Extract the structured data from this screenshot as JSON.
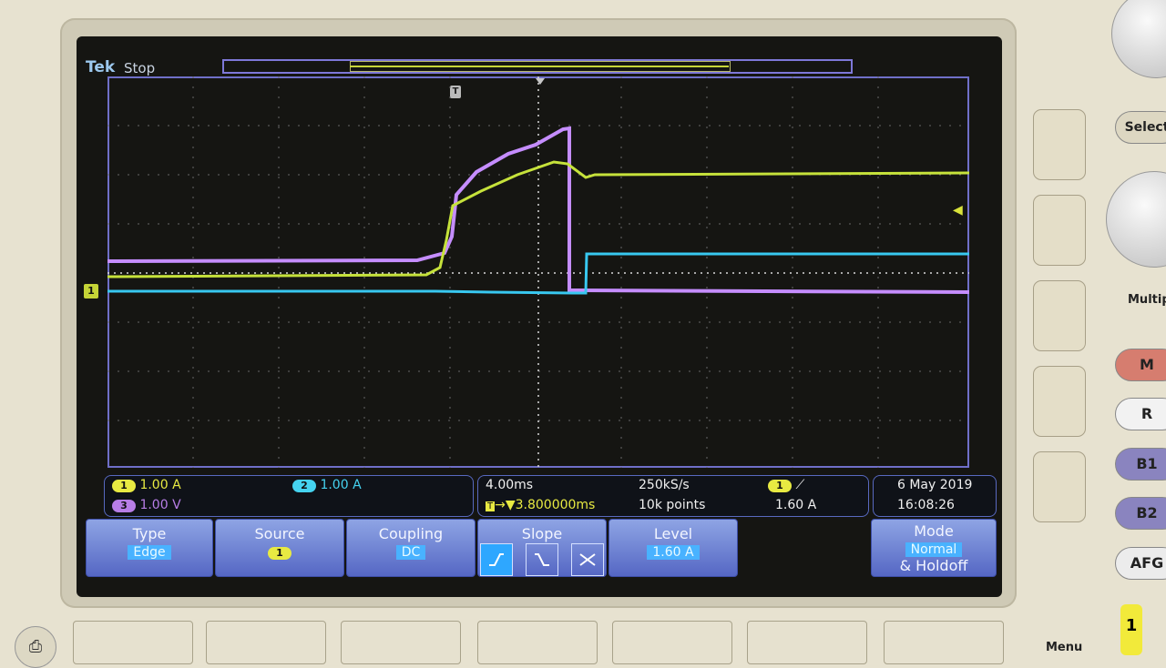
{
  "brand": "Tek",
  "acquisition_state": "Stop",
  "trigger_position_marker": "T",
  "channel_marker": "1",
  "status": {
    "channels": [
      {
        "id": "1",
        "scale": "1.00 A",
        "color": "#e8ea42"
      },
      {
        "id": "2",
        "scale": "1.00 A",
        "color": "#45d3f0"
      },
      {
        "id": "3",
        "scale": "1.00 V",
        "color": "#b87ee7"
      }
    ],
    "timebase": "4.00ms",
    "sample_rate": "250kS/s",
    "trigger_delay": "3.800000ms",
    "record_length": "10k points",
    "trigger_channel": "1",
    "trigger_level": "1.60 A",
    "date": "6 May 2019",
    "time": "16:08:26"
  },
  "menu": {
    "type": {
      "label": "Type",
      "value": "Edge"
    },
    "source": {
      "label": "Source",
      "value": "1"
    },
    "coupling": {
      "label": "Coupling",
      "value": "DC"
    },
    "slope": {
      "label": "Slope",
      "selected": "rising"
    },
    "level": {
      "label": "Level",
      "value": "1.60 A"
    },
    "mode": {
      "label": "Mode",
      "value": "Normal",
      "suffix": "& Holdoff"
    }
  },
  "front_panel": {
    "select_label": "Select",
    "multipurpose_label": "Multip",
    "m_label": "M",
    "r_label": "R",
    "b1_label": "B1",
    "b2_label": "B2",
    "afg_label": "AFG",
    "menu_label": "Menu",
    "channel_button_label": "1"
  }
}
